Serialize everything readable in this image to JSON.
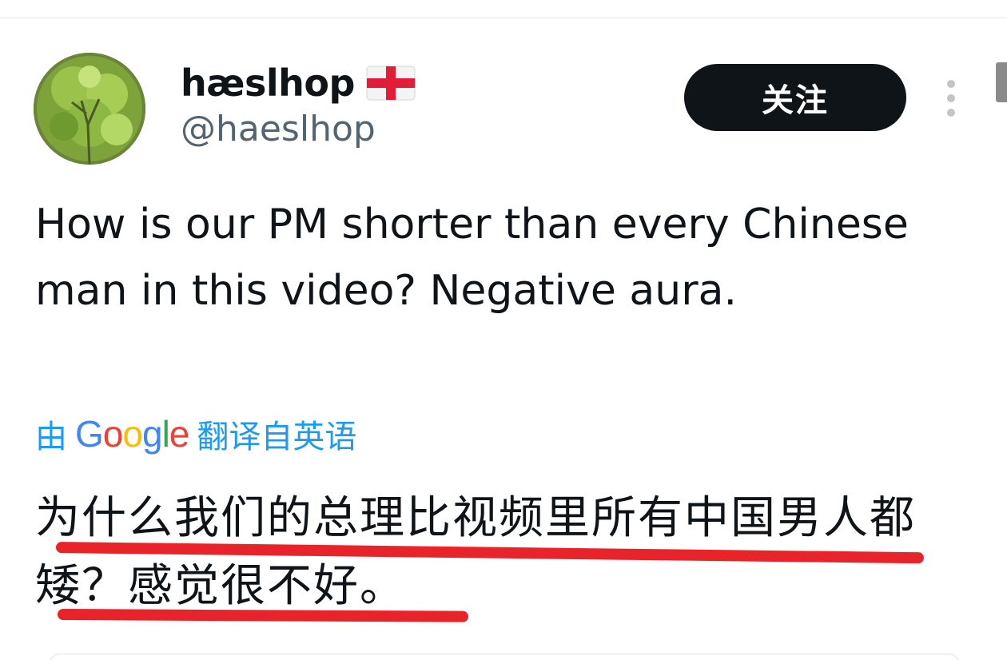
{
  "author": {
    "display_name": "hæslhop",
    "handle": "@haeslhop",
    "flag": "england-flag-icon"
  },
  "follow_button": {
    "label": "关注"
  },
  "tweet": {
    "text": "How is our PM shorter than every Chinese man in this video? Negative aura."
  },
  "translation": {
    "prefix": "由",
    "provider": "Google",
    "suffix": "翻译自英语",
    "text": "为什么我们的总理比视频里所有中国男人都矮？感觉很不好。"
  },
  "colors": {
    "text": "#0f1419",
    "secondary": "#536471",
    "link": "#1d9bf0",
    "button_bg": "#0f1419",
    "underline": "#e8242a",
    "google_blue": "#4285f4",
    "google_red": "#ea4335",
    "google_yellow": "#fbbc05",
    "google_green": "#34a853"
  }
}
